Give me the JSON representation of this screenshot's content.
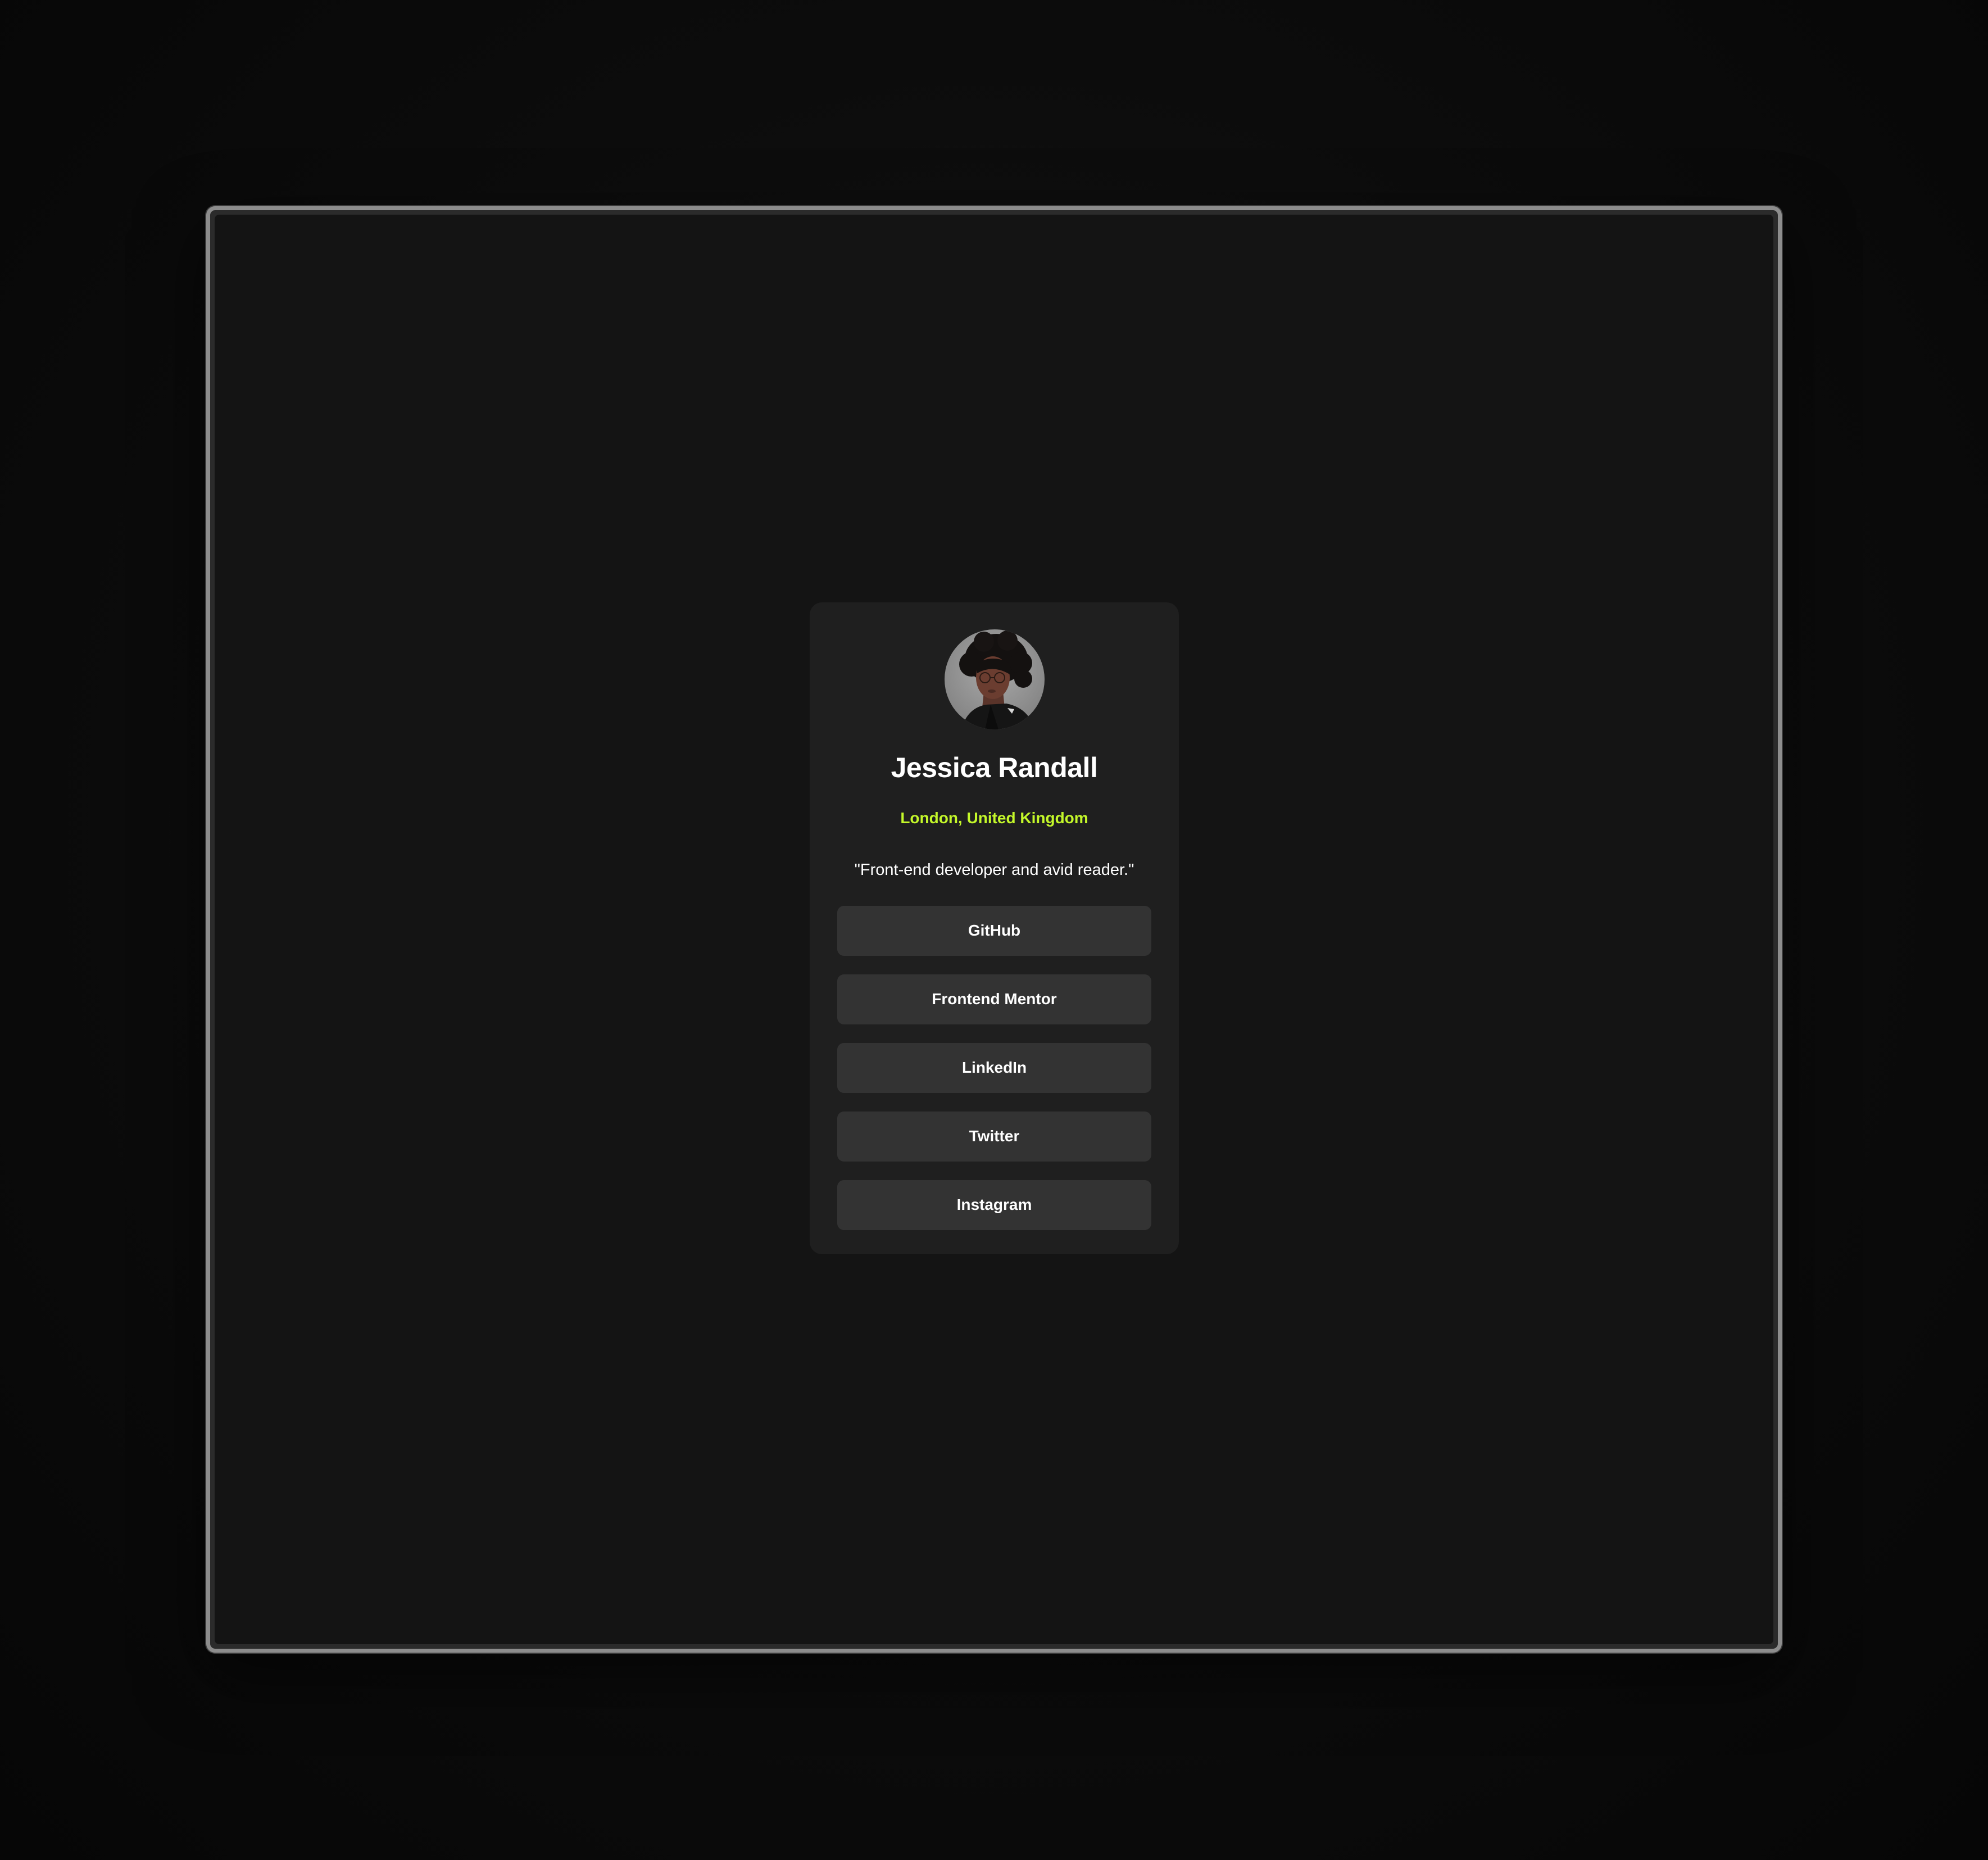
{
  "profile": {
    "name": "Jessica Randall",
    "location": "London, United Kingdom",
    "bio": "\"Front-end developer and avid reader.\"",
    "avatar_icon": "avatar-photo"
  },
  "links": [
    {
      "label": "GitHub"
    },
    {
      "label": "Frontend Mentor"
    },
    {
      "label": "LinkedIn"
    },
    {
      "label": "Twitter"
    },
    {
      "label": "Instagram"
    }
  ],
  "colors": {
    "page_background": "#141414",
    "card_background": "#1f1f1f",
    "button_background": "#333333",
    "accent": "#c4f82a",
    "text": "#ffffff"
  }
}
